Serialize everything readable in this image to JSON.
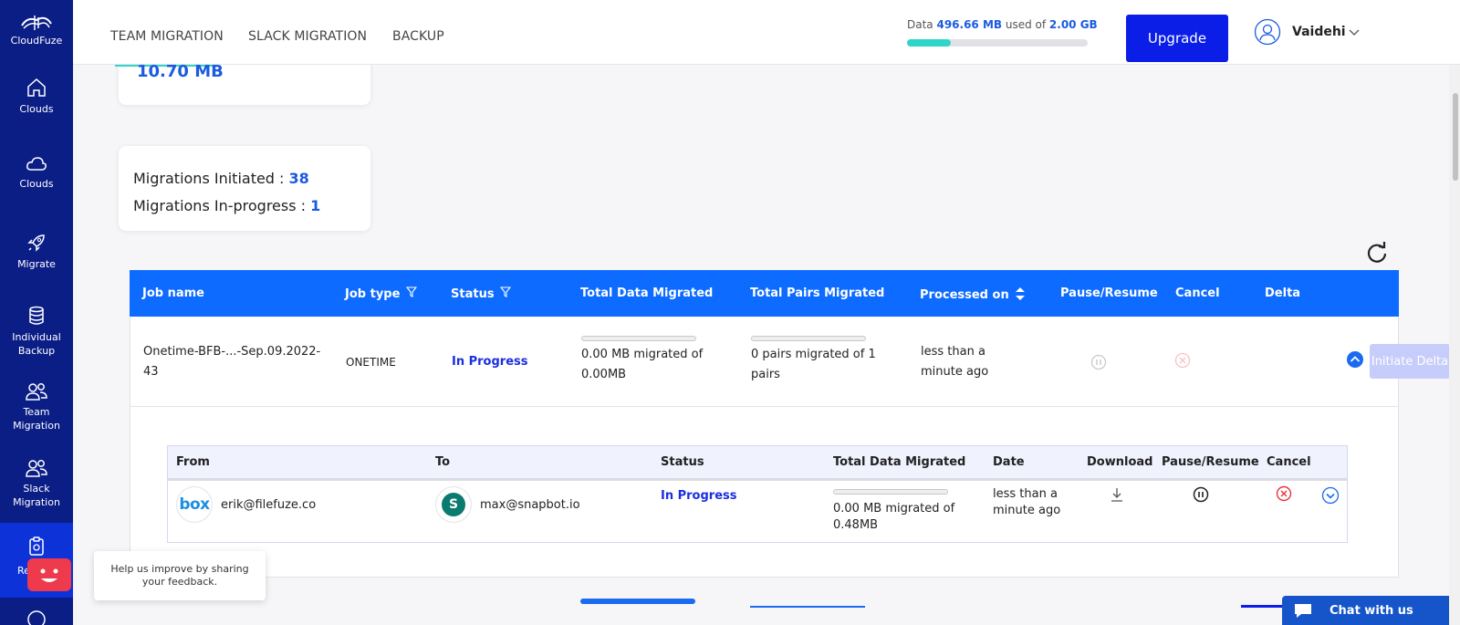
{
  "app": {
    "brand": "CloudFuze"
  },
  "sidebar": {
    "items": [
      {
        "label": "Clouds",
        "icon": "home-icon"
      },
      {
        "label": "Clouds",
        "icon": "cloud-icon"
      },
      {
        "label": "Migrate",
        "icon": "rocket-icon"
      },
      {
        "label": "Individual Backup",
        "icon": "database-icon"
      },
      {
        "label": "Team Migration",
        "icon": "users-icon"
      },
      {
        "label": "Slack Migration",
        "icon": "users-icon"
      },
      {
        "label": "Re",
        "icon": "report-icon"
      }
    ]
  },
  "header": {
    "tabs": [
      "TEAM MIGRATION",
      "SLACK MIGRATION",
      "BACKUP"
    ],
    "storage": {
      "prefix": "Data ",
      "used": "496.66 MB",
      "middle": " used of ",
      "total": "2.00 GB",
      "fraction": 0.24
    },
    "upgrade_label": "Upgrade",
    "user_name": "Vaidehi"
  },
  "summary": {
    "size_value": "10.70 MB",
    "initiated_label": "Migrations Initiated : ",
    "initiated_value": "38",
    "inprogress_label": "Migrations In-progress : ",
    "inprogress_value": "1"
  },
  "jobs_table": {
    "headers": [
      "Job name",
      "Job type",
      "Status",
      "Total Data Migrated",
      "Total Pairs Migrated",
      "Processed on",
      "Pause/Resume",
      "Cancel",
      "Delta"
    ],
    "rows": [
      {
        "job_name_1": "Onetime-BFB-...-Sep.09.2022-",
        "job_name_2": "43",
        "job_type": "ONETIME",
        "status": "In Progress",
        "data_1": "0.00 MB migrated of",
        "data_2": "0.00MB",
        "pairs_1": "0 pairs migrated of 1",
        "pairs_2": "pairs",
        "processed_1": "less than a",
        "processed_2": "minute ago",
        "delta_label": "Initiate Delta"
      }
    ]
  },
  "pairs_table": {
    "headers": [
      "From",
      "To",
      "Status",
      "Total Data Migrated",
      "Date",
      "Download",
      "Pause/Resume",
      "Cancel"
    ],
    "rows": [
      {
        "from_email": "erik@filefuze.co",
        "from_logo": "box",
        "to_email": "max@snapbot.io",
        "to_logo": "S",
        "status": "In Progress",
        "data_1": "0.00 MB migrated of",
        "data_2": "0.48MB",
        "date_1": "less than a",
        "date_2": "minute ago"
      }
    ]
  },
  "feedback": {
    "text": "Help us improve by sharing your feedback."
  },
  "chat": {
    "label": "Chat with us"
  },
  "colors": {
    "sidebar": "#0b1e86",
    "accent": "#0d6bff",
    "upgrade": "#0a1ee8",
    "teal": "#2fd6c7"
  }
}
